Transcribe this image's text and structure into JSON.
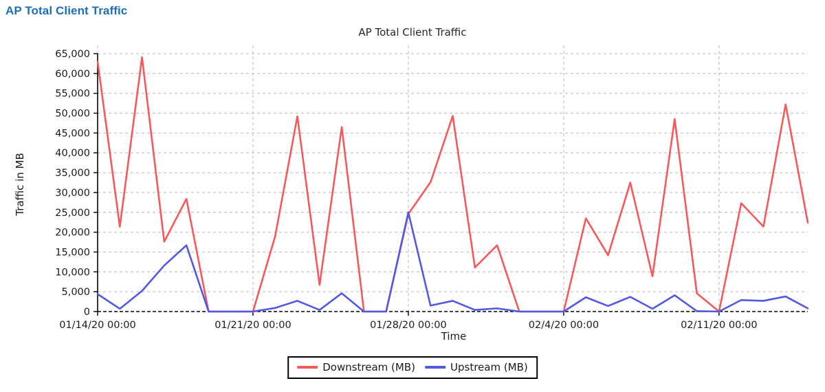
{
  "page": {
    "header_title": "AP Total Client Traffic",
    "header_color": "#1f6eb5"
  },
  "chart_data": {
    "type": "line",
    "title": "AP Total Client Traffic",
    "xlabel": "Time",
    "ylabel": "Traffic in MB",
    "grid": true,
    "legend_position": "bottom-center",
    "ylim": [
      0,
      65000
    ],
    "yticks": [
      0,
      5000,
      10000,
      15000,
      20000,
      25000,
      30000,
      35000,
      40000,
      45000,
      50000,
      55000,
      60000,
      65000
    ],
    "ytick_labels": [
      "0",
      "5,000",
      "10,000",
      "15,000",
      "20,000",
      "25,000",
      "30,000",
      "35,000",
      "40,000",
      "45,000",
      "50,000",
      "55,000",
      "60,000",
      "65,000"
    ],
    "xtick_labels": [
      "01/14/20 00:00",
      "01/21/20 00:00",
      "01/28/20 00:00",
      "02/4/20 00:00",
      "02/11/20 00:00"
    ],
    "xtick_indices": [
      0,
      7,
      14,
      21,
      28
    ],
    "x": [
      "01/14/20",
      "01/15/20",
      "01/16/20",
      "01/17/20",
      "01/18/20",
      "01/19/20",
      "01/20/20",
      "01/21/20",
      "01/22/20",
      "01/23/20",
      "01/24/20",
      "01/25/20",
      "01/26/20",
      "01/27/20",
      "01/28/20",
      "01/29/20",
      "01/30/20",
      "01/31/20",
      "02/1/20",
      "02/2/20",
      "02/3/20",
      "02/4/20",
      "02/5/20",
      "02/6/20",
      "02/7/20",
      "02/8/20",
      "02/9/20",
      "02/10/20",
      "02/11/20",
      "02/12/20",
      "02/13/20",
      "02/14/20"
    ],
    "series": [
      {
        "name": "Downstream (MB)",
        "color": "#f4595b",
        "values": [
          63000,
          21400,
          64100,
          17600,
          28400,
          0,
          0,
          0,
          19000,
          49200,
          6700,
          46500,
          0,
          0,
          24600,
          32600,
          49300,
          11100,
          16700,
          0,
          0,
          0,
          23500,
          14200,
          32500,
          8900,
          48500,
          4600,
          0,
          27300,
          21400,
          52200
        ]
      },
      {
        "name": "Upstream (MB)",
        "color": "#5159e0",
        "values": [
          4400,
          700,
          5200,
          11600,
          16700,
          0,
          0,
          0,
          900,
          2700,
          400,
          4600,
          0,
          0,
          25000,
          1500,
          2700,
          400,
          800,
          0,
          0,
          0,
          3600,
          1400,
          3700,
          700,
          4100,
          100,
          0,
          2900,
          2700,
          3800
        ]
      }
    ],
    "last_x": "02/15/20",
    "last_values": {
      "downstream": 22400,
      "upstream": 800
    }
  },
  "legend": {
    "items": [
      {
        "label": "Downstream (MB)",
        "color": "#f4595b",
        "icon": "line-swatch-icon"
      },
      {
        "label": "Upstream (MB)",
        "color": "#5159e0",
        "icon": "line-swatch-icon"
      }
    ]
  }
}
